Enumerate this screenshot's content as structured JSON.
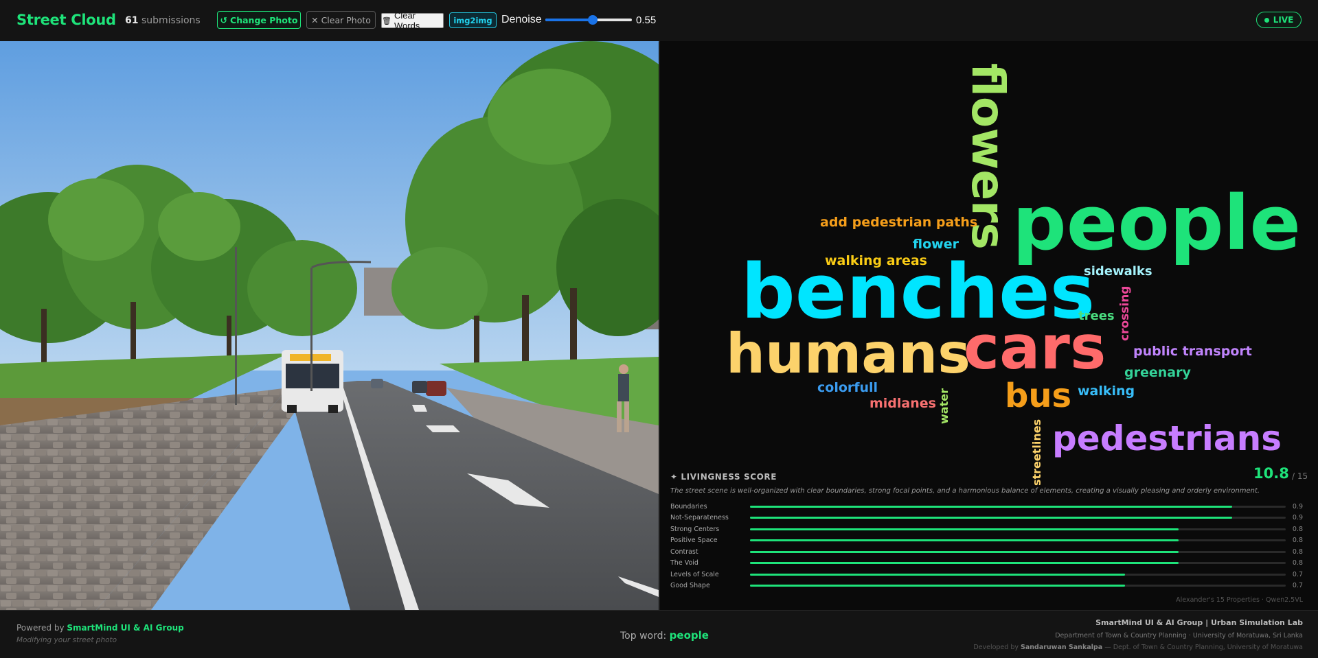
{
  "header": {
    "brand": "Street Cloud",
    "submission_count": "61",
    "submission_label": "submissions",
    "change_photo_label": "Change Photo",
    "clear_photo_label": "Clear Photo",
    "clear_words_label": "Clear Words",
    "img2img_label": "img2img",
    "denoise_label": "Denoise",
    "denoise_value": "0.55",
    "denoise_fraction": 0.55,
    "live_label": "LIVE"
  },
  "word_cloud": [
    {
      "text": "flowers",
      "color": "#a3e665",
      "orient": "vertical"
    },
    {
      "text": "people",
      "color": "#1ee37a",
      "orient": "horizontal"
    },
    {
      "text": "add pedestrian paths",
      "color": "#f59e1a",
      "orient": "horizontal"
    },
    {
      "text": "flower",
      "color": "#22d3ee",
      "orient": "horizontal"
    },
    {
      "text": "walking areas",
      "color": "#facc15",
      "orient": "horizontal"
    },
    {
      "text": "sidewalks",
      "color": "#a5f3fc",
      "orient": "horizontal"
    },
    {
      "text": "benches",
      "color": "#00e5ff",
      "orient": "horizontal"
    },
    {
      "text": "crossing",
      "color": "#ec4899",
      "orient": "vertical-up"
    },
    {
      "text": "trees",
      "color": "#4ade80",
      "orient": "horizontal"
    },
    {
      "text": "humans",
      "color": "#fcd26b",
      "orient": "horizontal"
    },
    {
      "text": "cars",
      "color": "#ff6b6b",
      "orient": "horizontal"
    },
    {
      "text": "public transport",
      "color": "#c084fc",
      "orient": "horizontal"
    },
    {
      "text": "greenary",
      "color": "#34d399",
      "orient": "horizontal"
    },
    {
      "text": "colorfull",
      "color": "#3b9cf0",
      "orient": "horizontal"
    },
    {
      "text": "bus",
      "color": "#f59e1a",
      "orient": "horizontal"
    },
    {
      "text": "walking",
      "color": "#38bdf8",
      "orient": "horizontal"
    },
    {
      "text": "midlanes",
      "color": "#f87171",
      "orient": "horizontal"
    },
    {
      "text": "water",
      "color": "#a3e665",
      "orient": "vertical-up"
    },
    {
      "text": "pedestrians",
      "color": "#c77dff",
      "orient": "horizontal"
    },
    {
      "text": "streetlines",
      "color": "#fcd26b",
      "orient": "vertical-up"
    }
  ],
  "score": {
    "heading": "✦ LIVINGNESS SCORE",
    "value": "10.8",
    "max": "/ 15",
    "description": "The street scene is well-organized with clear boundaries, strong focal points, and a harmonious balance of elements, creating a visually pleasing and orderly environment.",
    "metrics": [
      {
        "name": "Boundaries",
        "value": "0.9",
        "fraction": 0.9
      },
      {
        "name": "Not-Separateness",
        "value": "0.9",
        "fraction": 0.9
      },
      {
        "name": "Strong Centers",
        "value": "0.8",
        "fraction": 0.8
      },
      {
        "name": "Positive Space",
        "value": "0.8",
        "fraction": 0.8
      },
      {
        "name": "Contrast",
        "value": "0.8",
        "fraction": 0.8
      },
      {
        "name": "The Void",
        "value": "0.8",
        "fraction": 0.8
      },
      {
        "name": "Levels of Scale",
        "value": "0.7",
        "fraction": 0.7
      },
      {
        "name": "Good Shape",
        "value": "0.7",
        "fraction": 0.7
      }
    ],
    "credit": "Alexander's 15 Properties · Qwen2.5VL"
  },
  "footer": {
    "powered_prefix": "Powered by",
    "powered_by": "SmartMind UI & AI Group",
    "modifying": "Modifying your street photo",
    "top_word_label": "Top word:",
    "top_word": "people",
    "org_line": "SmartMind UI & AI Group  |  Urban Simulation Lab",
    "dept_line": "Department of Town & Country Planning · University of Moratuwa, Sri Lanka",
    "dev_prefix": "Developed by",
    "developer": "Sandaruwan Sankalpa",
    "dev_suffix": "— Dept. of Town & Country Planning, University of Moratuwa"
  },
  "colors": {
    "accent": "#1ee37a",
    "slider": "#1a73e8"
  }
}
